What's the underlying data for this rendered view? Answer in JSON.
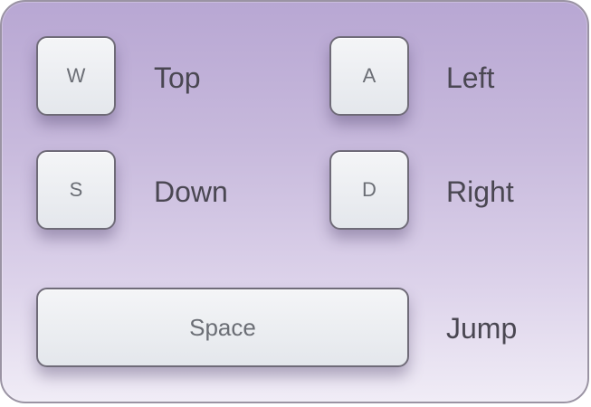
{
  "controls": [
    {
      "key": "W",
      "action": "Top"
    },
    {
      "key": "A",
      "action": "Left"
    },
    {
      "key": "S",
      "action": "Down"
    },
    {
      "key": "D",
      "action": "Right"
    },
    {
      "key": "Space",
      "action": "Jump"
    }
  ]
}
